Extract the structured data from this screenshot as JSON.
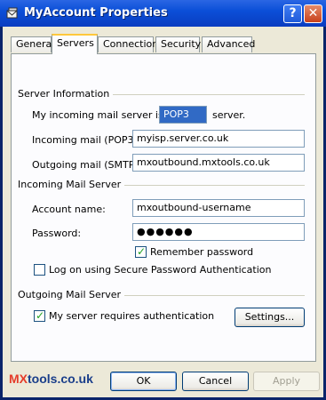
{
  "window": {
    "title": "MyAccount Properties",
    "help_button": "?",
    "close_button": "✕"
  },
  "tabs": [
    {
      "label": "General",
      "active": false
    },
    {
      "label": "Servers",
      "active": true
    },
    {
      "label": "Connection",
      "active": false
    },
    {
      "label": "Security",
      "active": false
    },
    {
      "label": "Advanced",
      "active": false
    }
  ],
  "server_information": {
    "group_label": "Server Information",
    "incoming_type_prefix": "My incoming mail server is a",
    "incoming_type_value": "POP3",
    "incoming_type_suffix": "server.",
    "incoming_label": "Incoming mail (POP3):",
    "incoming_value": "myisp.server.co.uk",
    "outgoing_label": "Outgoing mail (SMTP):",
    "outgoing_value": "mxoutbound.mxtools.co.uk"
  },
  "incoming_mail_server": {
    "group_label": "Incoming Mail Server",
    "account_label": "Account name:",
    "account_value": "mxoutbound-username",
    "password_label": "Password:",
    "password_value": "●●●●●●",
    "remember_label": "Remember password",
    "remember_checked": true,
    "spa_label": "Log on using Secure Password Authentication",
    "spa_checked": false
  },
  "outgoing_mail_server": {
    "group_label": "Outgoing Mail Server",
    "auth_label": "My server requires authentication",
    "auth_checked": true,
    "settings_button": "Settings..."
  },
  "footer": {
    "logo_mx": "MX",
    "logo_rest": "tools.co.uk",
    "ok_button": "OK",
    "cancel_button": "Cancel",
    "apply_button": "Apply"
  }
}
